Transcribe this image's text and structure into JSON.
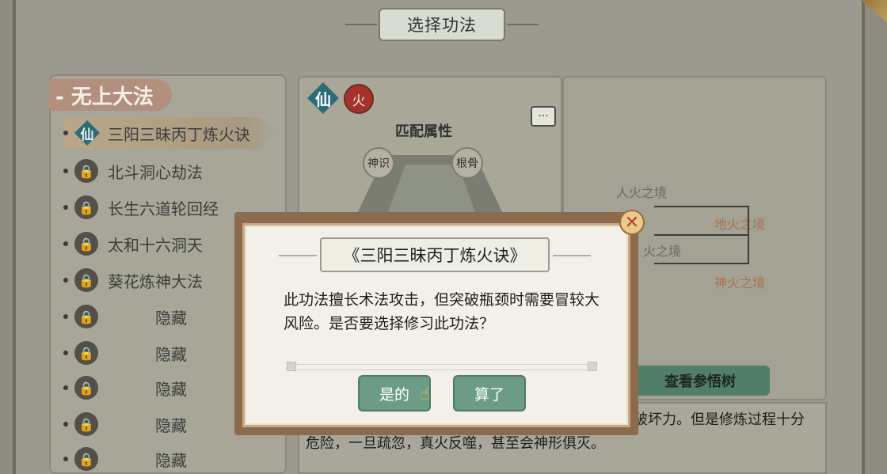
{
  "window": {
    "title": "选择功法"
  },
  "sidebar": {
    "section_title": "- 无上大法",
    "items": [
      {
        "label": "三阳三昧丙丁炼火诀",
        "icon": "xian-icon",
        "selected": true
      },
      {
        "label": "北斗洞心劫法",
        "icon": "lock-icon"
      },
      {
        "label": "长生六道轮回经",
        "icon": "lock-icon"
      },
      {
        "label": "太和十六洞天",
        "icon": "lock-icon"
      },
      {
        "label": "葵花炼神大法",
        "icon": "lock-icon"
      },
      {
        "label": "隐藏",
        "icon": "lock-icon"
      },
      {
        "label": "隐藏",
        "icon": "lock-icon"
      },
      {
        "label": "隐藏",
        "icon": "lock-icon"
      },
      {
        "label": "隐藏",
        "icon": "lock-icon"
      },
      {
        "label": "隐藏",
        "icon": "lock-icon"
      }
    ]
  },
  "detail": {
    "badge_xian": "仙",
    "badge_fire": "火",
    "match_title": "匹配属性",
    "attr_1": "神识",
    "attr_2": "根骨",
    "tree_labels": [
      "人火之境",
      "地火之境",
      "火之境",
      "神火之境"
    ],
    "tree_button": "查看参悟树",
    "description": "阳三阳经略，凝结天地人三才之火，无物不燃，极具破坏力。但是修炼过程十分危险，一旦疏忽，真火反噬，甚至会神形俱灭。"
  },
  "dialog": {
    "title": "《三阳三昧丙丁炼火诀》",
    "message": "此功法擅长术法攻击，但突破瓶颈时需要冒较大风险。是否要选择修习此功法？",
    "confirm_label": "是的",
    "cancel_label": "算了",
    "close_symbol": "✕"
  },
  "icons": {
    "lock": "🔒",
    "chat": "···",
    "cursor": "☝"
  },
  "colors": {
    "accent_green": "#6d9c86",
    "fire_red": "#a3322a",
    "xian_teal": "#2c6c78"
  }
}
